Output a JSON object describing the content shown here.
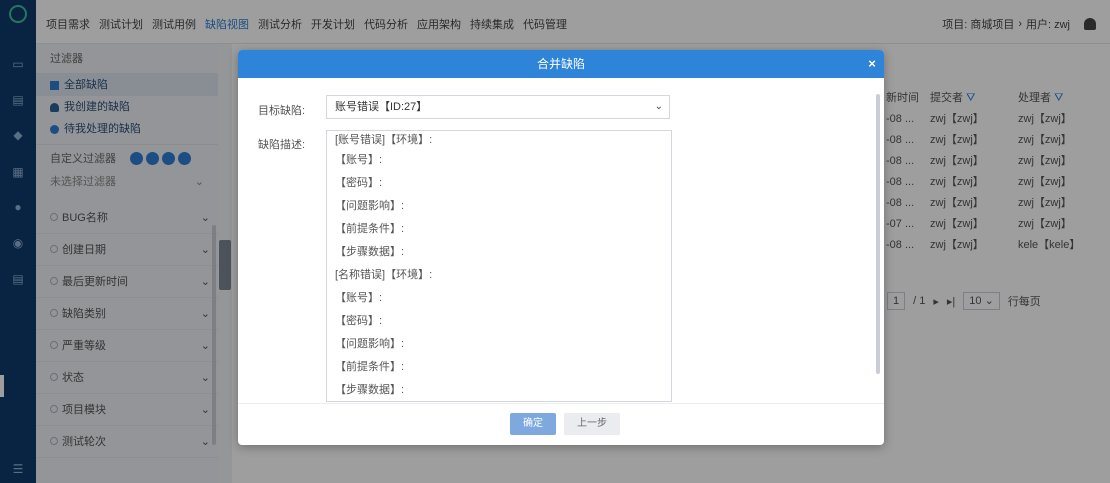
{
  "topnav": {
    "items": [
      "项目需求",
      "测试计划",
      "测试用例",
      "缺陷视图",
      "测试分析",
      "开发计划",
      "代码分析",
      "应用架构",
      "持续集成",
      "代码管理"
    ],
    "project_label": "项目: 商城项目",
    "user_label": "用户: zwj"
  },
  "filter": {
    "title": "过滤器",
    "items": [
      "全部缺陷",
      "我创建的缺陷",
      "待我处理的缺陷"
    ],
    "custom_label": "自定义过滤器",
    "select_placeholder": "未选择过滤器",
    "fields": [
      "BUG名称",
      "创建日期",
      "最后更新时间",
      "缺陷类别",
      "严重等级",
      "状态",
      "项目模块",
      "测试轮次"
    ]
  },
  "table": {
    "headers": [
      "新时间",
      "提交者",
      "处理者"
    ],
    "dates": [
      "-08 ...",
      "-08 ...",
      "-08 ...",
      "-08 ...",
      "-08 ...",
      "-07 ...",
      "-08 ..."
    ],
    "submitters": [
      "zwj【zwj】",
      "zwj【zwj】",
      "zwj【zwj】",
      "zwj【zwj】",
      "zwj【zwj】",
      "zwj【zwj】",
      "zwj【zwj】"
    ],
    "handlers": [
      "zwj【zwj】",
      "zwj【zwj】",
      "zwj【zwj】",
      "zwj【zwj】",
      "zwj【zwj】",
      "zwj【zwj】",
      "kele【kele】"
    ]
  },
  "pager": {
    "page": "1",
    "total": "/ 1",
    "per_page": "10",
    "per_page_label": "行每页"
  },
  "modal": {
    "title": "合并缺陷",
    "target_label": "目标缺陷:",
    "target_value": "账号错误【ID:27】",
    "desc_label": "缺陷描述:",
    "desc_lines": [
      "[账号错误]【环境】:",
      "【账号】:",
      "【密码】:",
      "【问题影响】:",
      "【前提条件】:",
      "【步骤数据】:",
      "[名称错误]【环境】:",
      "【账号】:",
      "【密码】:",
      "【问题影响】:",
      "【前提条件】:",
      "【步骤数据】:"
    ],
    "ok_label": "确定",
    "prev_label": "上一步"
  },
  "colors": {
    "accent": "#2d84d8",
    "rail": "#0d3a6b"
  }
}
